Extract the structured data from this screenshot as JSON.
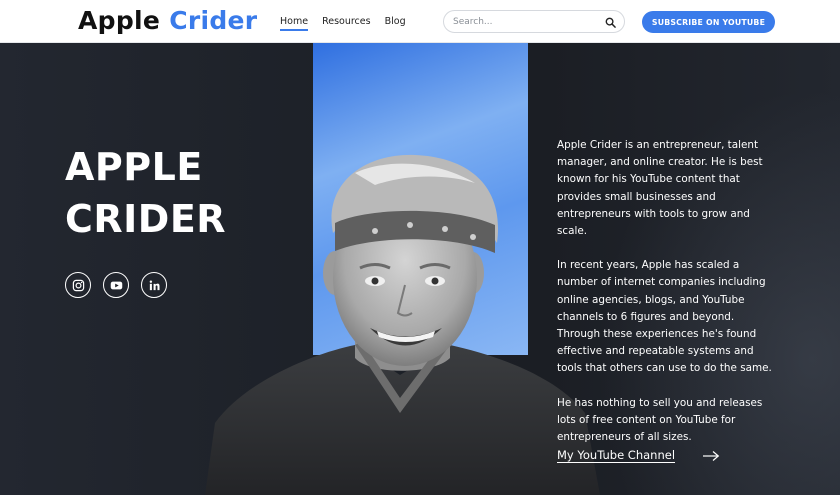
{
  "header": {
    "logo_word1": "Apple",
    "logo_word2": "Crider",
    "nav": [
      {
        "label": "Home",
        "active": true
      },
      {
        "label": "Resources",
        "active": false
      },
      {
        "label": "Blog",
        "active": false
      }
    ],
    "search": {
      "placeholder": "Search...",
      "value": "",
      "icon": "search-icon"
    },
    "subscribe_label": "SUBSCRIBE ON YOUTUBE"
  },
  "hero": {
    "title_line1": "APPLE",
    "title_line2": "CRIDER",
    "socials": [
      {
        "name": "instagram",
        "icon": "instagram-icon"
      },
      {
        "name": "youtube",
        "icon": "youtube-icon"
      },
      {
        "name": "linkedin",
        "icon": "linkedin-icon"
      }
    ],
    "bio": [
      "Apple Crider is an entrepreneur, talent manager, and online creator. He is best known for his YouTube content that provides small businesses and entrepreneurs with tools to grow and scale.",
      "In recent years, Apple has scaled a number of internet companies including online agencies, blogs, and YouTube channels to 6 figures and beyond. Through these experiences he's found effective and repeatable systems and tools that others can use to do the same.",
      "He has nothing to sell you and releases lots of free content on YouTube for entrepreneurs of all sizes."
    ],
    "channel_link": "My YouTube Channel",
    "arrow_icon": "arrow-right-icon"
  },
  "colors": {
    "accent": "#3a7bea",
    "dark_bg": "#1e2126",
    "panel_blue": "#5e98ee"
  }
}
